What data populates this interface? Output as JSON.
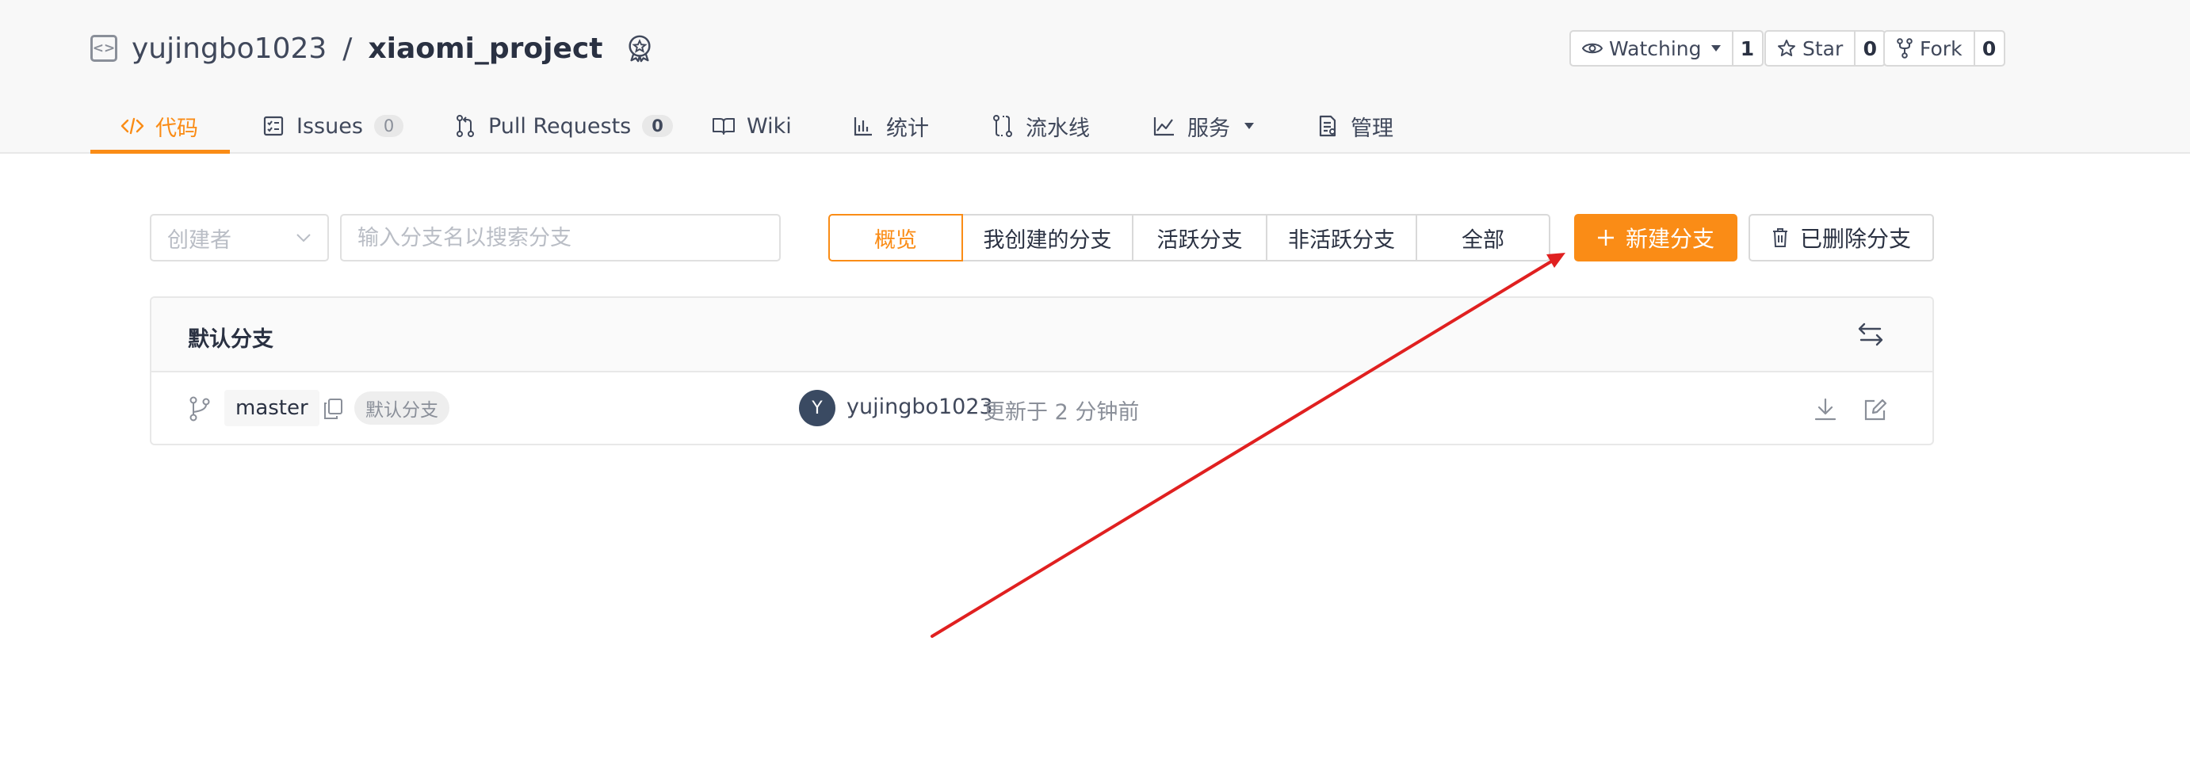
{
  "repo": {
    "owner": "yujingbo1023",
    "separator": "/",
    "name": "xiaomi_project"
  },
  "actions": {
    "watch": {
      "label": "Watching",
      "count": "1"
    },
    "star": {
      "label": "Star",
      "count": "0"
    },
    "fork": {
      "label": "Fork",
      "count": "0"
    }
  },
  "tabs": [
    {
      "label": "代码",
      "icon": "code-icon",
      "active": true
    },
    {
      "label": "Issues",
      "count": "0",
      "icon": "issues-icon"
    },
    {
      "label": "Pull Requests",
      "count": "0",
      "icon": "pull-request-icon"
    },
    {
      "label": "Wiki",
      "icon": "wiki-icon"
    },
    {
      "label": "统计",
      "icon": "stats-icon"
    },
    {
      "label": "流水线",
      "icon": "pipeline-icon"
    },
    {
      "label": "服务",
      "icon": "service-icon",
      "dropdown": true
    },
    {
      "label": "管理",
      "icon": "manage-icon"
    }
  ],
  "toolbar": {
    "creator_placeholder": "创建者",
    "search_placeholder": "输入分支名以搜索分支",
    "filters": [
      "概览",
      "我创建的分支",
      "活跃分支",
      "非活跃分支",
      "全部"
    ],
    "new_branch": "新建分支",
    "deleted_branches": "已删除分支"
  },
  "panel": {
    "title": "默认分支",
    "branch": {
      "name": "master",
      "tag": "默认分支",
      "avatar_letter": "Y",
      "author": "yujingbo1023",
      "updated": "更新于 2 分钟前"
    }
  },
  "colors": {
    "accent": "#fa8c16",
    "annotation_arrow": "#e02020",
    "avatar": "#3a4a62"
  }
}
